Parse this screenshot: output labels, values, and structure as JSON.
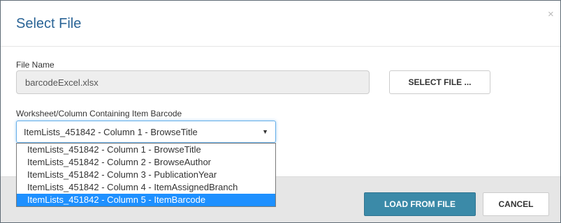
{
  "dialog": {
    "title": "Select File",
    "close_glyph": "×"
  },
  "file": {
    "label": "File Name",
    "value": "barcodeExcel.xlsx",
    "select_button": "SELECT FILE ..."
  },
  "worksheet": {
    "label": "Worksheet/Column Containing Item Barcode",
    "selected_value": "ItemLists_451842 - Column 1 - BrowseTitle",
    "options": [
      "ItemLists_451842 - Column 1 - BrowseTitle",
      "ItemLists_451842 - Column 2 - BrowseAuthor",
      "ItemLists_451842 - Column 3 - PublicationYear",
      "ItemLists_451842 - Column 4 - ItemAssignedBranch",
      "ItemLists_451842 - Column 5 - ItemBarcode"
    ],
    "highlighted_index": 4
  },
  "footer": {
    "load_button": "LOAD FROM FILE",
    "cancel_button": "CANCEL"
  },
  "colors": {
    "title": "#2a6496",
    "primary_button": "#3b8aa8",
    "highlight": "#1e90ff",
    "footer_bg": "#e6e6e6"
  },
  "icons": {
    "close": "close-icon",
    "dropdown": "dropdown-arrow-icon"
  }
}
